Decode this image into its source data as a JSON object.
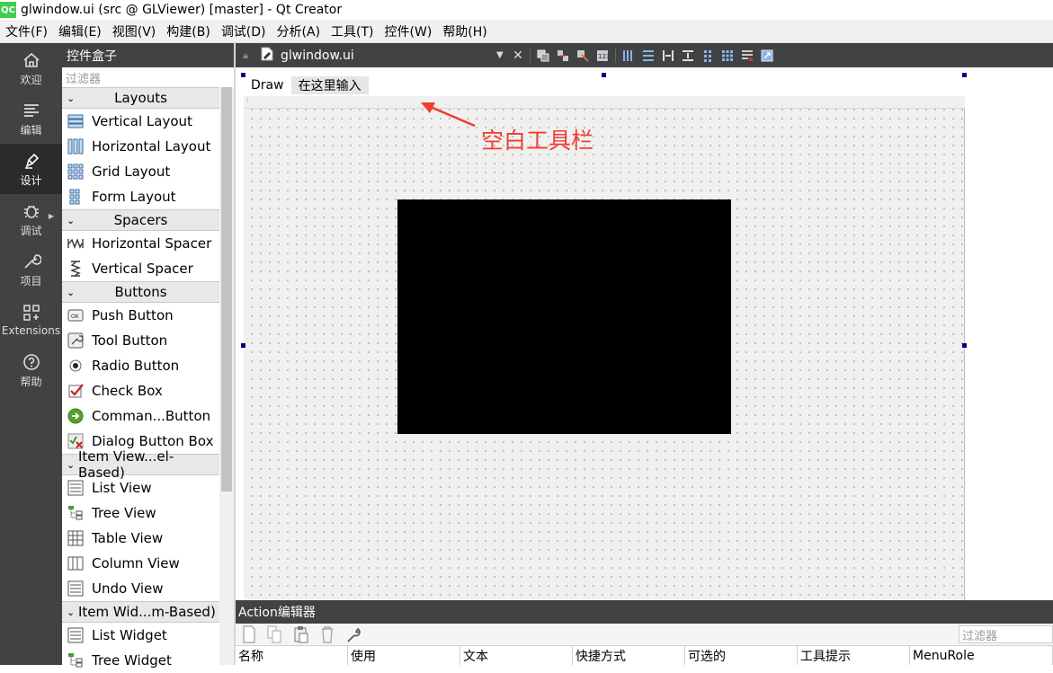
{
  "window": {
    "title": "glwindow.ui (src @ GLViewer) [master] - Qt Creator",
    "logo": "QC"
  },
  "menubar": [
    "文件(F)",
    "编辑(E)",
    "视图(V)",
    "构建(B)",
    "调试(D)",
    "分析(A)",
    "工具(T)",
    "控件(W)",
    "帮助(H)"
  ],
  "modebar": [
    {
      "label": "欢迎",
      "icon": "home-icon",
      "active": false
    },
    {
      "label": "编辑",
      "icon": "edit-icon",
      "active": false
    },
    {
      "label": "设计",
      "icon": "design-pen-icon",
      "active": true
    },
    {
      "label": "调试",
      "icon": "bug-icon",
      "active": false
    },
    {
      "label": "项目",
      "icon": "wrench-icon",
      "active": false
    },
    {
      "label": "Extensions",
      "icon": "extensions-icon",
      "active": false
    },
    {
      "label": "帮助",
      "icon": "help-icon",
      "active": false
    }
  ],
  "widgetbox": {
    "title": "控件盒子",
    "filter_placeholder": "过滤器",
    "categories": [
      {
        "label": "Layouts",
        "items": [
          "Vertical Layout",
          "Horizontal Layout",
          "Grid Layout",
          "Form Layout"
        ]
      },
      {
        "label": "Spacers",
        "items": [
          "Horizontal Spacer",
          "Vertical Spacer"
        ]
      },
      {
        "label": "Buttons",
        "items": [
          "Push Button",
          "Tool Button",
          "Radio Button",
          "Check Box",
          "Comman...Button",
          "Dialog Button Box"
        ]
      },
      {
        "label": "Item View...el-Based)",
        "items": [
          "List View",
          "Tree View",
          "Table View",
          "Column View",
          "Undo View"
        ]
      },
      {
        "label": "Item Wid...m-Based)",
        "items": [
          "List Widget",
          "Tree Widget"
        ]
      }
    ]
  },
  "document": {
    "filename": "glwindow.ui"
  },
  "form": {
    "menu_items": [
      "Draw"
    ],
    "menu_placeholder": "在这里输入",
    "annotation": "空白工具栏"
  },
  "action_editor": {
    "title": "Action编辑器",
    "filter_placeholder": "过滤器",
    "columns": [
      "名称",
      "使用",
      "文本",
      "快捷方式",
      "可选的",
      "工具提示",
      "MenuRole"
    ]
  },
  "colors": {
    "annotation": "#f03c2e",
    "dark_panel": "#404244",
    "selection_handle": "#000080"
  }
}
